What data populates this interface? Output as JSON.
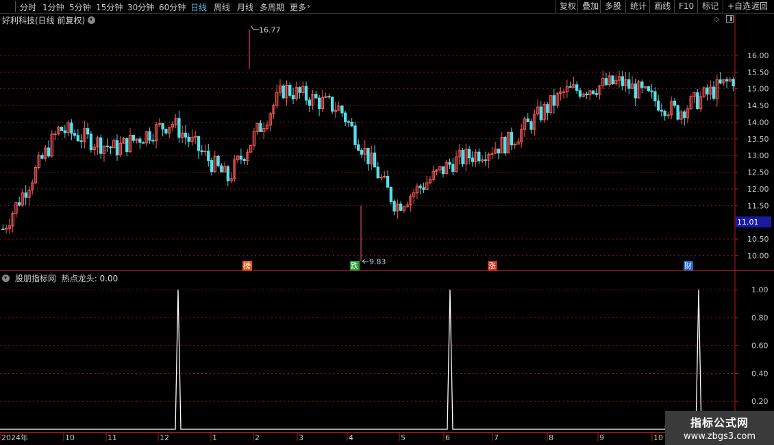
{
  "toolbar": {
    "timeframes": [
      "分时",
      "1分钟",
      "5分钟",
      "15分钟",
      "30分钟",
      "60分钟",
      "日线",
      "周线",
      "月线",
      "多周期",
      "更多"
    ],
    "active_timeframe": "日线",
    "more_chevron": "chevron-right-icon",
    "tools": [
      "复权",
      "叠加",
      "多股",
      "统计",
      "画线",
      "F10",
      "标记",
      "+自选",
      "返回"
    ]
  },
  "main_panel": {
    "title": "好利科技(日线 前复权)",
    "title_icon": "chevron-down-icon",
    "corner_icons": [
      "diamond-icon",
      "panel-toggle-icon"
    ],
    "high_label": "16.77",
    "low_label": "9.83",
    "current_price_label": "11.01",
    "price_ticks": [
      "16.00",
      "15.50",
      "15.00",
      "14.50",
      "14.00",
      "13.50",
      "13.00",
      "12.50",
      "12.00",
      "11.50",
      "10.50",
      "10.00"
    ],
    "markers": [
      {
        "text": "榜",
        "color": "#e05a1a"
      },
      {
        "text": "跌",
        "color": "#1f9e2f"
      },
      {
        "text": "涨",
        "color": "#c8281e"
      },
      {
        "text": "财",
        "color": "#1e64c8"
      }
    ]
  },
  "indicator_panel": {
    "source": "股朋指标网",
    "name": "热点龙头",
    "value_text": ": 0.00",
    "icon": "chevron-down-icon",
    "ticks": [
      "1.00",
      "0.80",
      "0.60",
      "0.40",
      "0.20"
    ]
  },
  "x_axis": {
    "labels": [
      "2024年",
      "10",
      "11",
      "12",
      "1",
      "2",
      "3",
      "4",
      "5",
      "6",
      "7",
      "8",
      "9",
      "10"
    ]
  },
  "watermark": {
    "line1": "指标公式网",
    "line2": "www.zbgs3.com"
  },
  "colors": {
    "up": "#ff5a5a",
    "down": "#54e0e8",
    "grid": "#8a1a1a",
    "axis": "#b41e1e",
    "price_badge": "#1a1aa0",
    "active_tab": "#4fc3f7"
  },
  "chart_data": {
    "type": "candlestick",
    "title": "好利科技(日线 前复权)",
    "x_range": [
      "2024-09",
      "2025-10"
    ],
    "price_axis_range": [
      9.6,
      16.9
    ],
    "highest": 16.77,
    "lowest": 9.83,
    "last": 11.01,
    "price_trend": [
      {
        "period": "2024-09",
        "close": 10.8
      },
      {
        "period": "2024-10",
        "close": 13.8
      },
      {
        "period": "2024-11",
        "close": 13.2
      },
      {
        "period": "2024-12",
        "close": 14.0
      },
      {
        "period": "2025-01",
        "close": 12.3
      },
      {
        "period": "2025-02",
        "close": 15.0
      },
      {
        "period": "2025-03",
        "close": 14.4
      },
      {
        "period": "2025-04",
        "close": 11.5
      },
      {
        "period": "2025-05",
        "close": 12.8
      },
      {
        "period": "2025-06",
        "close": 13.4
      },
      {
        "period": "2025-07",
        "close": 14.9
      },
      {
        "period": "2025-08",
        "close": 15.2
      },
      {
        "period": "2025-09",
        "close": 14.3
      },
      {
        "period": "2025-10",
        "close": 15.3
      }
    ],
    "indicator": {
      "name": "热点龙头",
      "range": [
        0,
        1
      ],
      "signals": [
        {
          "month": "2024-12",
          "value": 1.0
        },
        {
          "month": "2025-06",
          "value": 1.0
        },
        {
          "month": "2025-10",
          "value": 1.0
        }
      ]
    }
  }
}
